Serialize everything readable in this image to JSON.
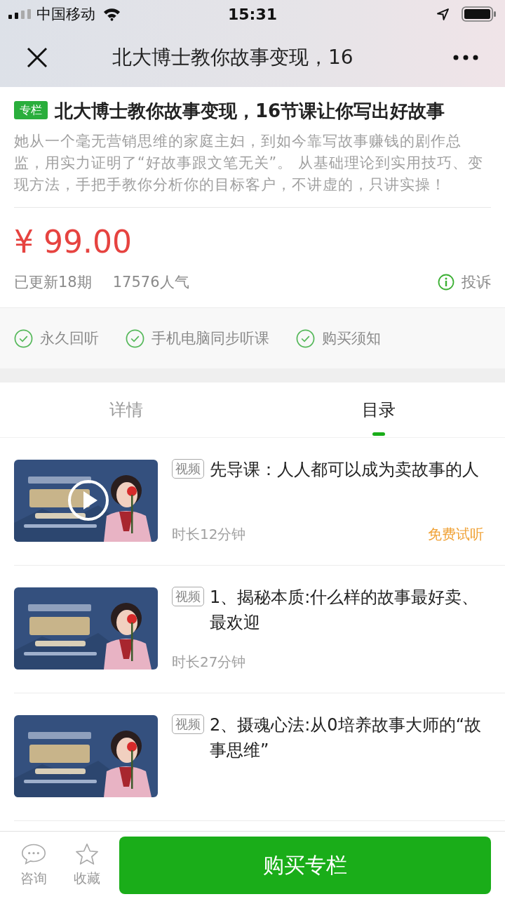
{
  "status_bar": {
    "carrier": "中国移动",
    "time": "15:31"
  },
  "nav_bar": {
    "title": "北大博士教你故事变现，16"
  },
  "column": {
    "tag": "专栏",
    "title": "北大博士教你故事变现，16节课让你写出好故事",
    "description": "她从一个毫无营销思维的家庭主妇，到如今靠写故事赚钱的剧作总监，用实力证明了“好故事跟文笔无关”。 从基础理论到实用技巧、变现方法，手把手教你分析你的目标客户，不讲虚的，只讲实操！",
    "price": "¥ 99.00",
    "updates": "已更新18期",
    "popularity": "17576人气",
    "report": "投诉"
  },
  "features": [
    "永久回听",
    "手机电脑同步听课",
    "购买须知"
  ],
  "tabs": [
    {
      "label": "详情",
      "selected": false
    },
    {
      "label": "目录",
      "selected": true
    }
  ],
  "lessons": [
    {
      "current": true,
      "type": "视频",
      "title": "先导课：人人都可以成为卖故事的人",
      "duration": "时长12分钟",
      "free_label": "免费试听"
    },
    {
      "current": false,
      "type": "视频",
      "title": "1、揭秘本质:什么样的故事最好卖、最欢迎",
      "duration": "时长27分钟"
    },
    {
      "current": false,
      "type": "视频",
      "title": "2、摄魂心法:从0培养故事大师的“故事思维”"
    }
  ],
  "bottom_bar": {
    "consult": "咨询",
    "favorite": "收藏",
    "buy": "购买专栏"
  }
}
